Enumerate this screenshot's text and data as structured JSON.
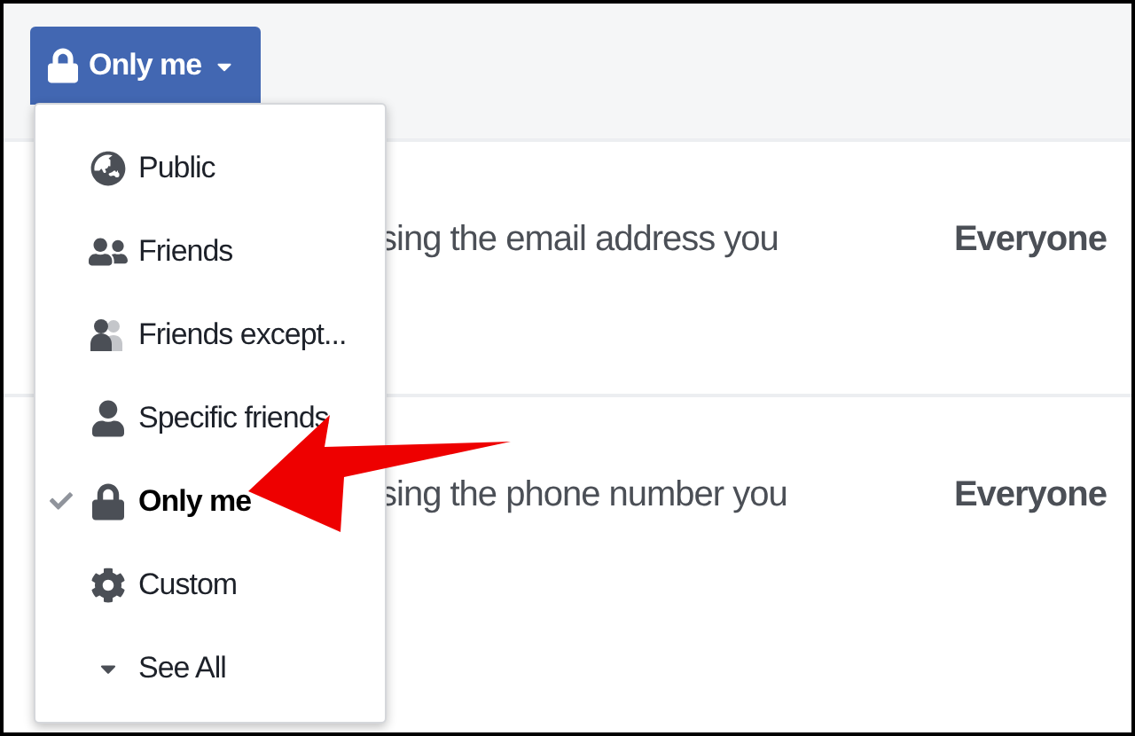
{
  "privacy_button": {
    "label": "Only me"
  },
  "menu": {
    "items": [
      {
        "label": "Public",
        "kind": "globe",
        "selected": false
      },
      {
        "label": "Friends",
        "kind": "friends",
        "selected": false
      },
      {
        "label": "Friends except...",
        "kind": "friends-except",
        "selected": false
      },
      {
        "label": "Specific friends",
        "kind": "person",
        "selected": false
      },
      {
        "label": "Only me",
        "kind": "lock",
        "selected": true
      },
      {
        "label": "Custom",
        "kind": "gear",
        "selected": false
      },
      {
        "label": "See All",
        "kind": "caret",
        "selected": false
      }
    ]
  },
  "rows": [
    {
      "description": "sing the email address you",
      "audience": "Everyone"
    },
    {
      "description": "sing the phone number you",
      "audience": "Everyone"
    }
  ]
}
